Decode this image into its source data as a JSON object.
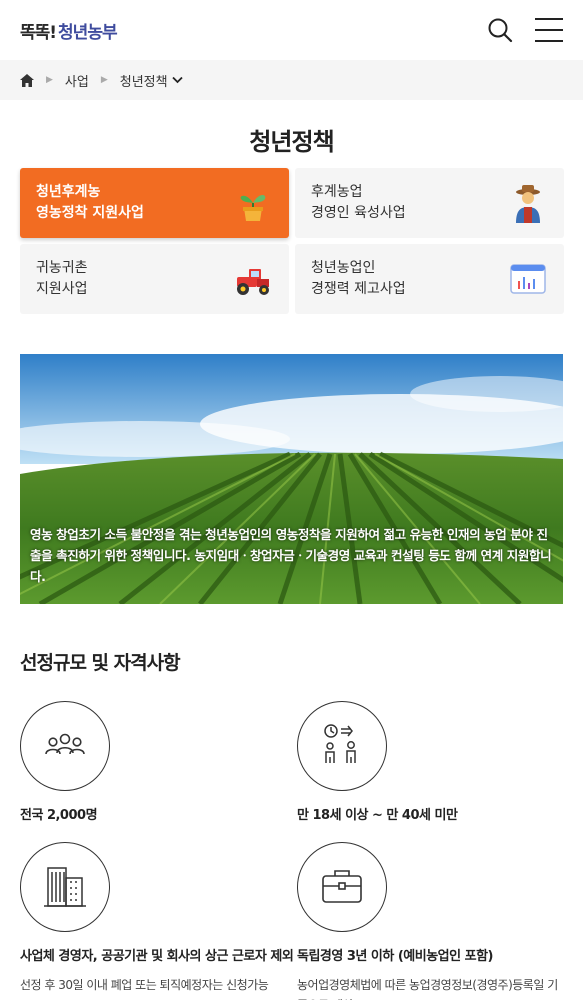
{
  "header": {
    "logo_text_1": "똑똑!",
    "logo_text_2": "청년농부",
    "search_icon": "search-icon",
    "menu_icon": "hamburger-menu-icon"
  },
  "breadcrumb": {
    "home_icon": "home-icon",
    "items": [
      "사업",
      "청년정책"
    ]
  },
  "page_title": "청년정책",
  "menu": [
    {
      "label": "청년후계농\n영농정착 지원사업",
      "icon": "sprout-pot-icon",
      "active": true
    },
    {
      "label": "후계농업\n경영인 육성사업",
      "icon": "farmer-icon",
      "active": false
    },
    {
      "label": "귀농귀촌\n지원사업",
      "icon": "tractor-icon",
      "active": false
    },
    {
      "label": "청년농업인\n경쟁력 제고사업",
      "icon": "chart-window-icon",
      "active": false
    }
  ],
  "hero": {
    "text": "영농 창업초기 소득 불안정을 겪는 청년농업인의 영농정착을 지원하여 젊고 유능한 인재의 농업 분야 진출을 촉진하기 위한 정책입니다. 농지임대ㆍ창업자금ㆍ기술경영 교육과 컨설팅 등도 함께 연계 지원합니다."
  },
  "section": {
    "title": "선정규모 및 자격사항",
    "items": [
      {
        "icon": "people-group-icon",
        "label": "전국 2,000명",
        "desc": ""
      },
      {
        "icon": "clock-persons-icon",
        "label": "만 18세 이상 ~ 만 40세 미만",
        "desc": ""
      },
      {
        "icon": "building-icon",
        "label": "사업체 경영자, 공공기관 및 회사의 상근 근로자 제외",
        "desc": "선정 후 30일 이내 폐업 또는 퇴직예정자는 신청가능"
      },
      {
        "icon": "briefcase-icon",
        "label": "독립경영 3년 이하 (예비농업인 포함)",
        "desc": "농어업경영체법에 따른 농업경영정보(경영주)등록일 기준으로 계산"
      }
    ]
  },
  "colors": {
    "accent": "#f26c22",
    "logo_blue": "#3f4c9e"
  }
}
